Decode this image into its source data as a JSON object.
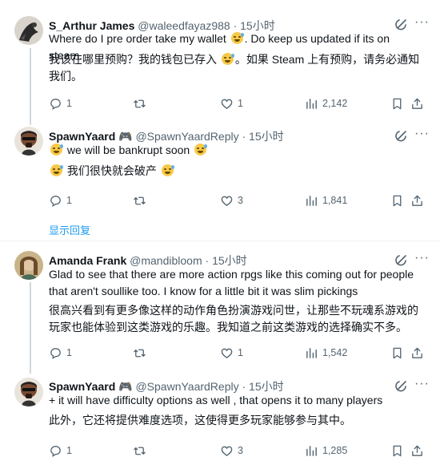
{
  "tweets": [
    {
      "name": "S_Arthur James",
      "handle": "@waleedfayaz988",
      "time": "· 15小时",
      "text_line1_a": "Where do I pre order take my wallet",
      "text_line1_b": ". Do keep us updated if its on steam.",
      "translation_a": "我该在哪里预购？我的钱包已存入",
      "translation_b": "。如果 Steam 上有预购，请务必通知我们。",
      "replies": "1",
      "likes": "1",
      "views": "2,142"
    },
    {
      "name": "SpawnYaard 🎮",
      "handle": "@SpawnYaardReply",
      "time": "· 15小时",
      "text_a": "we will be bankrupt soon",
      "translation_a": "我们很快就会破产",
      "replies": "1",
      "likes": "3",
      "views": "1,841",
      "show_replies": "显示回复"
    },
    {
      "name": "Amanda Frank",
      "handle": "@mandibloom",
      "time": "· 15小时",
      "text": "Glad to see that there are more action rpgs like this coming out for people that aren't soullike too. I know for a little bit it was slim pickings",
      "translation": "很高兴看到有更多像这样的动作角色扮演游戏问世，让那些不玩魂系游戏的玩家也能体验到这类游戏的乐趣。我知道之前这类游戏的选择确实不多。",
      "replies": "1",
      "likes": "1",
      "views": "1,542"
    },
    {
      "name": "SpawnYaard 🎮",
      "handle": "@SpawnYaardReply",
      "time": "· 15小时",
      "text": "+ it will have difficulty options as well , that opens it to many players",
      "translation": "此外，它还将提供难度选项，这使得更多玩家能够参与其中。",
      "replies": "1",
      "likes": "3",
      "views": "1,285"
    }
  ],
  "icons": [
    "grok-icon",
    "more-icon",
    "reply-icon",
    "retweet-icon",
    "like-icon",
    "views-icon",
    "bookmark-icon",
    "share-icon"
  ]
}
